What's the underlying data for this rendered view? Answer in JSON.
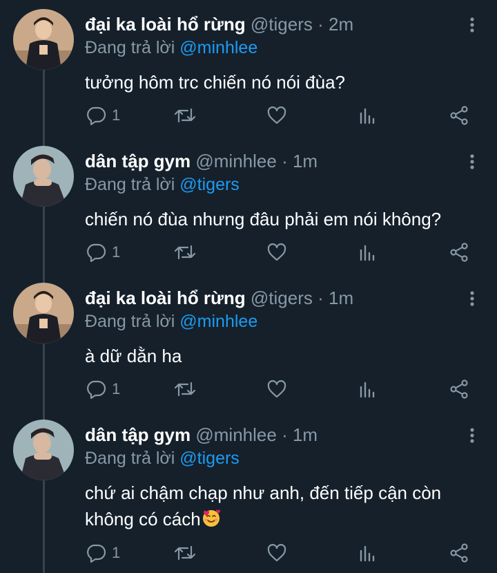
{
  "tweets": [
    {
      "name": "đại ka loài hổ rừng",
      "handle": "@tigers",
      "dot": "·",
      "time": "2m",
      "reply_prefix": "Đang trả lời",
      "reply_to": "@minhlee",
      "text": "tưởng hôm trc chiến nó nói đùa?",
      "reply_count": "1"
    },
    {
      "name": "dân tập gym",
      "handle": "@minhlee",
      "dot": "·",
      "time": "1m",
      "reply_prefix": "Đang trả lời",
      "reply_to": "@tigers",
      "text": "chiến nó đùa nhưng đâu phải em nói không?",
      "reply_count": "1"
    },
    {
      "name": "đại ka loài hổ rừng",
      "handle": "@tigers",
      "dot": "·",
      "time": "1m",
      "reply_prefix": "Đang trả lời",
      "reply_to": "@minhlee",
      "text": "à dữ dằn ha",
      "reply_count": "1"
    },
    {
      "name": "dân tập gym",
      "handle": "@minhlee",
      "dot": "·",
      "time": "1m",
      "reply_prefix": "Đang trả lời",
      "reply_to": "@tigers",
      "text": "chứ ai chậm chạp như anh, đến tiếp cận còn không có cách",
      "emoji": "smiling-face-with-hearts",
      "reply_count": "1"
    }
  ],
  "icons": {
    "reply": "reply-icon",
    "retweet": "retweet-icon",
    "like": "heart-icon",
    "stats": "stats-icon",
    "share": "share-icon",
    "more": "more-vertical-icon"
  },
  "colors": {
    "background": "#15202b",
    "text": "#ffffff",
    "muted": "#8899a6",
    "link": "#1d9bf0",
    "thread_line": "#38444d"
  }
}
